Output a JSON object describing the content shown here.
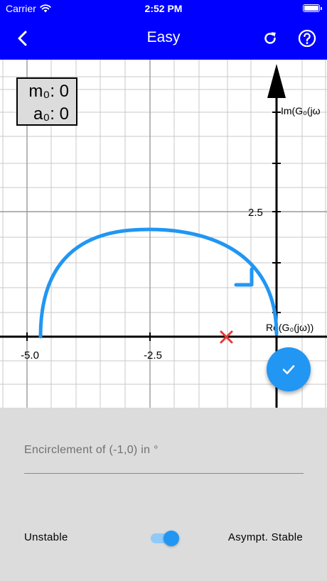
{
  "status_bar": {
    "carrier": "Carrier",
    "time": "2:52 PM"
  },
  "app_bar": {
    "title": "Easy",
    "icons": [
      "back-arrow-icon",
      "refresh-icon",
      "help-circle-icon"
    ]
  },
  "legend": {
    "m_label": "m₀: 0",
    "a_label": "a₀: 0"
  },
  "plot": {
    "x_ticks": [
      "-5.0",
      "-2.5"
    ],
    "y_ticks": [
      "2.5"
    ],
    "y_axis_label": "Im(G₀(jω",
    "x_axis_label": "Re(G₀(jω))",
    "critical_point": {
      "x": -1,
      "y": 0
    },
    "colors": {
      "curve": "#2196f3",
      "critical_marker": "#e53935"
    }
  },
  "fab": {
    "icon": "check-icon"
  },
  "form": {
    "encirclement_placeholder": "Encirclement of (-1,0) in °",
    "switch_left_label": "Unstable",
    "switch_right_label": "Asympt. Stable",
    "switch_on": true
  }
}
